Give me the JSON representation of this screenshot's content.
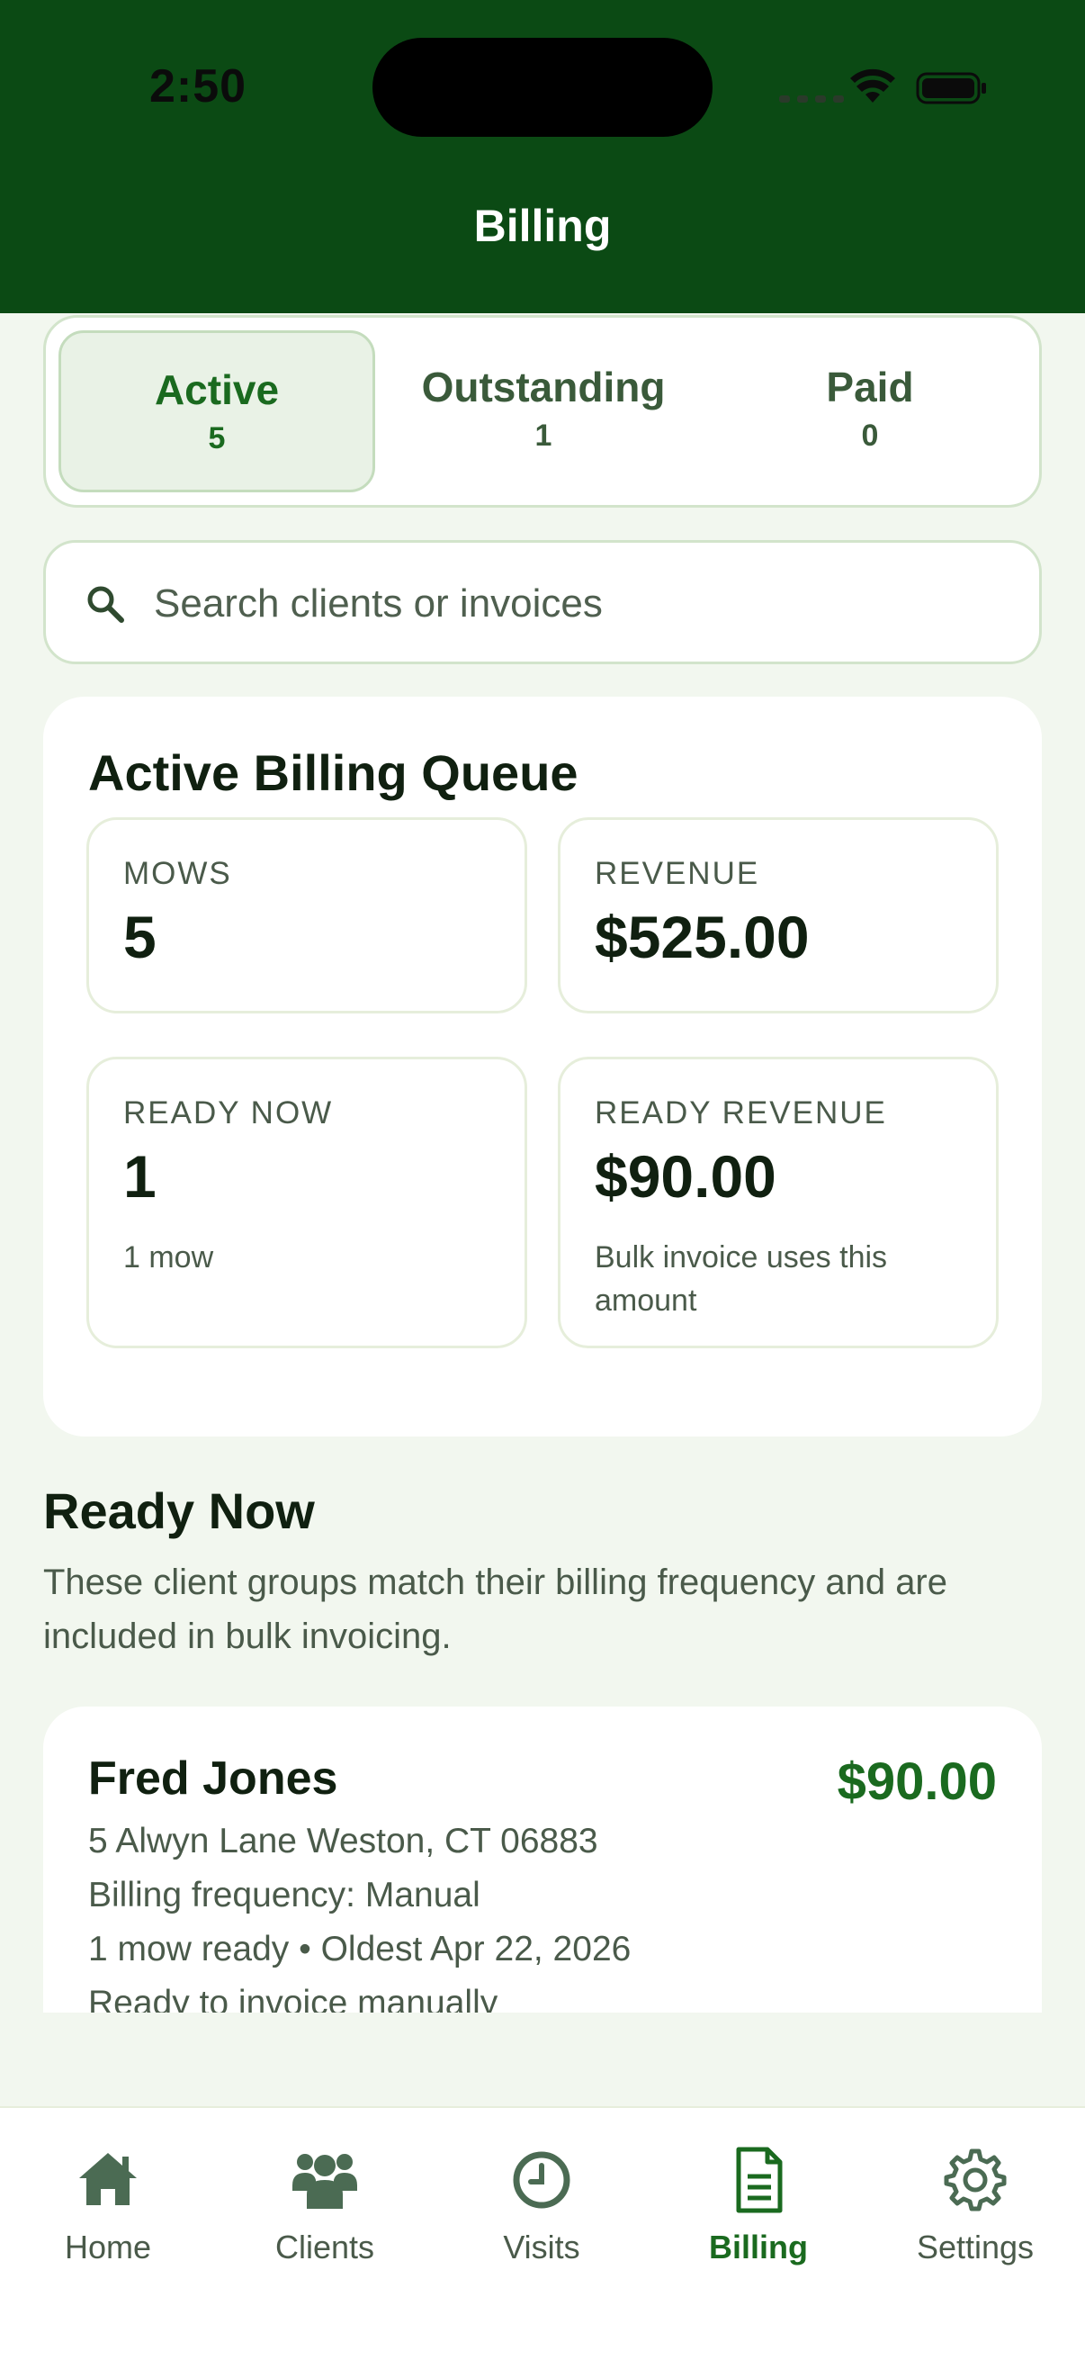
{
  "status_bar": {
    "time": "2:50"
  },
  "header": {
    "title": "Billing"
  },
  "segments": [
    {
      "label": "Active",
      "count": "5",
      "active": true
    },
    {
      "label": "Outstanding",
      "count": "1",
      "active": false
    },
    {
      "label": "Paid",
      "count": "0",
      "active": false
    }
  ],
  "search": {
    "placeholder": "Search clients or invoices",
    "value": ""
  },
  "queue": {
    "title": "Active Billing Queue",
    "stats": [
      {
        "label": "MOWS",
        "value": "5",
        "sub": ""
      },
      {
        "label": "REVENUE",
        "value": "$525.00",
        "sub": ""
      },
      {
        "label": "READY NOW",
        "value": "1",
        "sub": "1 mow"
      },
      {
        "label": "READY REVENUE",
        "value": "$90.00",
        "sub": "Bulk invoice uses this amount"
      }
    ]
  },
  "ready": {
    "title": "Ready Now",
    "description": "These client groups match their billing frequency and are included in bulk invoicing.",
    "clients": [
      {
        "name": "Fred Jones",
        "amount": "$90.00",
        "address": "5 Alwyn Lane Weston, CT 06883",
        "frequency": "Billing frequency: Manual",
        "summary": "1 mow ready  •  Oldest Apr 22, 2026",
        "note": "Ready to invoice manually"
      }
    ]
  },
  "tabbar": {
    "items": [
      {
        "label": "Home",
        "icon": "home-icon"
      },
      {
        "label": "Clients",
        "icon": "clients-icon"
      },
      {
        "label": "Visits",
        "icon": "clock-icon"
      },
      {
        "label": "Billing",
        "icon": "document-icon",
        "active": true
      },
      {
        "label": "Settings",
        "icon": "gear-icon"
      }
    ]
  },
  "colors": {
    "brand": "#0b4a14",
    "accent": "#1a6a1f",
    "background": "#f2f7ef"
  }
}
